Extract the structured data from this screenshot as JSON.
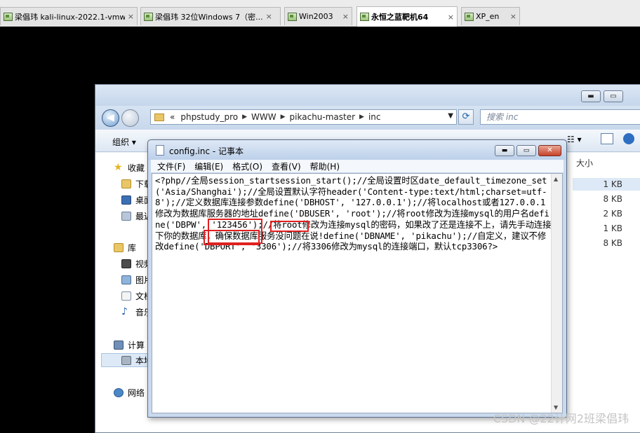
{
  "vm_tabs": [
    {
      "label": "梁倡玮  kali-linux-2022.1-vmw...",
      "close": "×"
    },
    {
      "label": "梁倡玮  32位Windows 7（密...",
      "close": "×"
    },
    {
      "label": "Win2003",
      "close": "×"
    },
    {
      "label": "永恒之蓝靶机64",
      "close": "×"
    },
    {
      "label": "XP_en",
      "close": "×"
    }
  ],
  "explorer": {
    "address": [
      "«",
      "phpstudy_pro",
      "WWW",
      "pikachu-master",
      "inc"
    ],
    "search_placeholder": "搜索 inc",
    "organize": "组织 ▾",
    "column_size": "大小",
    "nav": {
      "favorites": "收藏",
      "fav_items": [
        "下载",
        "桌面",
        "最近"
      ],
      "libraries": "库",
      "lib_items": [
        "视频",
        "图片",
        "文档",
        "音乐"
      ],
      "computer": "计算",
      "computer_items": [
        "本地"
      ],
      "network": "网络"
    },
    "sizes": [
      "1 KB",
      "8 KB",
      "2 KB",
      "1 KB",
      "8 KB"
    ]
  },
  "notepad": {
    "title": "config.inc - 记事本",
    "menus": [
      "文件(F)",
      "编辑(E)",
      "格式(O)",
      "查看(V)",
      "帮助(H)"
    ],
    "content": "<?php//全局session_startsession_start();//全局设置时区date_default_timezone_set('Asia/Shanghai');//全局设置默认字符header('Content-type:text/html;charset=utf-8');//定义数据库连接参数define('DBHOST', '127.0.0.1');//将localhost或者127.0.0.1修改为数据库服务器的地址define('DBUSER', 'root');//将root修改为连接mysql的用户名define('DBPW', '123456');//将root修改为连接mysql的密码，如果改了还是连接不上，请先手动连接下你的数据库，确保数据库服务没问题在说!define('DBNAME', 'pikachu');//自定义，建议不修改define('DBPORT', '3306');//将3306修改为mysql的连接端口，默认tcp3306?>"
  },
  "watermark": "CSDN @22计网2班梁倡玮",
  "colors": {
    "highlight_box": "#e02020",
    "desktop": "#000000"
  }
}
